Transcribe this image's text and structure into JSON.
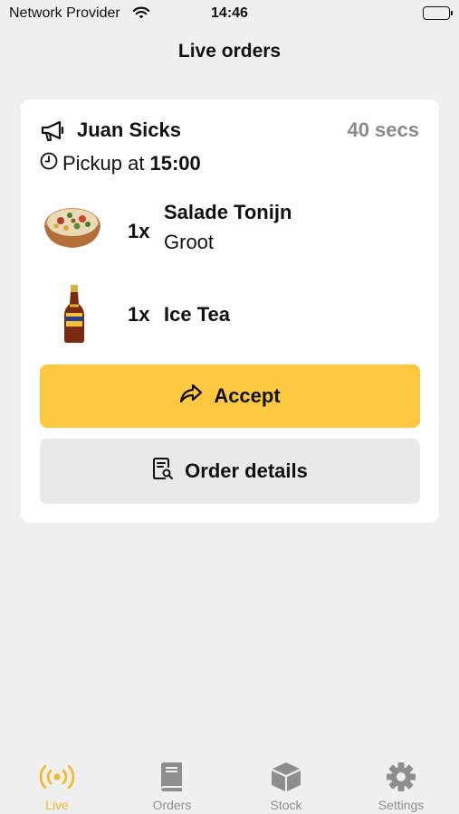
{
  "status_bar": {
    "carrier": "Network Provider",
    "time": "14:46"
  },
  "header": {
    "title": "Live orders"
  },
  "order": {
    "customer_name": "Juan Sicks",
    "elapsed": "40 secs",
    "pickup_label": "Pickup at",
    "pickup_time": "15:00",
    "items": [
      {
        "qty": "1x",
        "name": "Salade Tonijn",
        "variant": "Groot",
        "image": "salad-bowl-image"
      },
      {
        "qty": "1x",
        "name": "Ice Tea",
        "variant": "",
        "image": "ice-tea-bottle-image"
      }
    ],
    "accept_label": "Accept",
    "details_label": "Order details"
  },
  "tab_bar": {
    "tabs": [
      {
        "label": "Live",
        "icon": "broadcast-icon",
        "active": true
      },
      {
        "label": "Orders",
        "icon": "book-icon",
        "active": false
      },
      {
        "label": "Stock",
        "icon": "box-icon",
        "active": false
      },
      {
        "label": "Settings",
        "icon": "gear-icon",
        "active": false
      }
    ]
  },
  "colors": {
    "accent": "#fbc840",
    "active_tab": "#f2b824",
    "inactive_tab": "#8e8e8e",
    "background": "#efefef"
  }
}
